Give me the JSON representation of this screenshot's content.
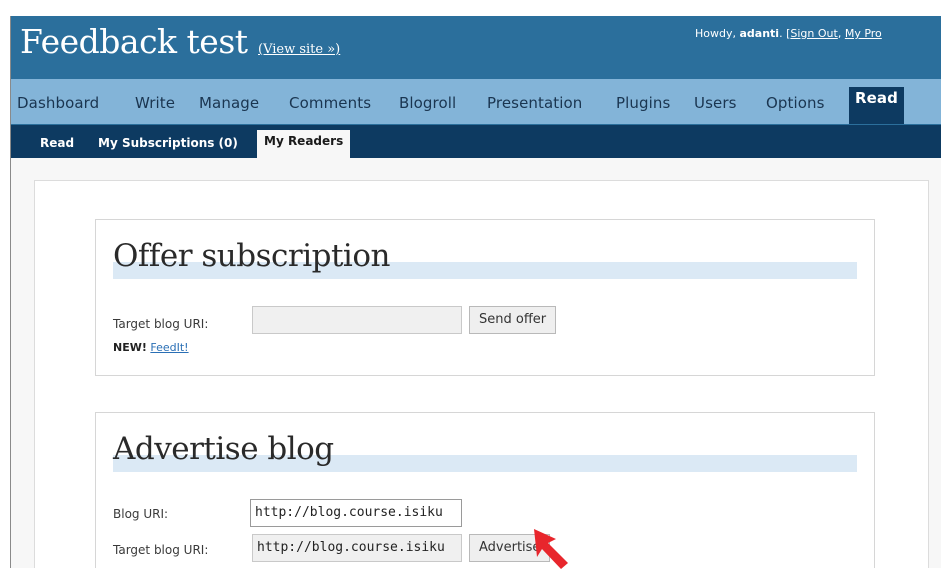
{
  "header": {
    "site_title": "Feedback test",
    "view_site_link": "(View site »)",
    "user_prefix": "Howdy,",
    "username": "adanti",
    "user_sep": ".",
    "sign_out_prefix": "[",
    "sign_out": "Sign Out",
    "comma": ",",
    "my_profile": "My Pro"
  },
  "menu": {
    "items": [
      "Dashboard",
      "Write",
      "Manage",
      "Comments",
      "Blogroll",
      "Presentation",
      "Plugins",
      "Users",
      "Options",
      "Read"
    ],
    "active": "Read"
  },
  "submenu": {
    "items": [
      "Read",
      "My Subscriptions (0)",
      "My Readers"
    ],
    "active": "My Readers"
  },
  "offer_panel": {
    "title": "Offer subscription",
    "target_label": "Target blog URI:",
    "target_value": "",
    "button_label": "Send offer",
    "new_badge": "NEW!",
    "feedit_link": "FeedIt!"
  },
  "advertise_panel": {
    "title": "Advertise blog",
    "blog_uri_label": "Blog URI:",
    "blog_uri_value": "http://blog.course.isiku",
    "target_label": "Target blog URI:",
    "target_value": "http://blog.course.isiku",
    "button_label": "Advertise"
  },
  "colors": {
    "header_bg": "#2b6f9c",
    "menu_bg": "#83b4d8",
    "submenu_bg": "#0d3a61",
    "cursor_red": "#e8262c"
  }
}
